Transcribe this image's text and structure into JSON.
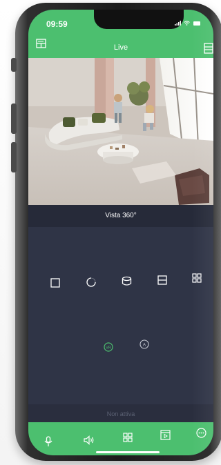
{
  "status_bar": {
    "time": "09:59",
    "signal_icon": "signal-icon",
    "wifi_icon": "wifi-icon",
    "battery_icon": "battery-icon"
  },
  "header": {
    "title": "Live",
    "left_icon": "layout-grid-icon",
    "right_icon": "list-panel-icon"
  },
  "video": {
    "description_icon": "camera-feed"
  },
  "view_mode": {
    "label": "Vista 360°"
  },
  "layout_options": [
    "single-view-icon",
    "fisheye-view-icon",
    "cylinder-view-icon",
    "split-two-icon",
    "quad-view-icon"
  ],
  "mode_toggles": [
    "vr-icon",
    "auto-icon"
  ],
  "status_text": "Non attiva",
  "bottom_nav": [
    "microphone-icon",
    "speaker-icon",
    "grid-icon",
    "playback-icon",
    "more-icon"
  ],
  "colors": {
    "accent": "#4cbf6f",
    "panel": "#2f3446",
    "bar": "#262a39"
  }
}
